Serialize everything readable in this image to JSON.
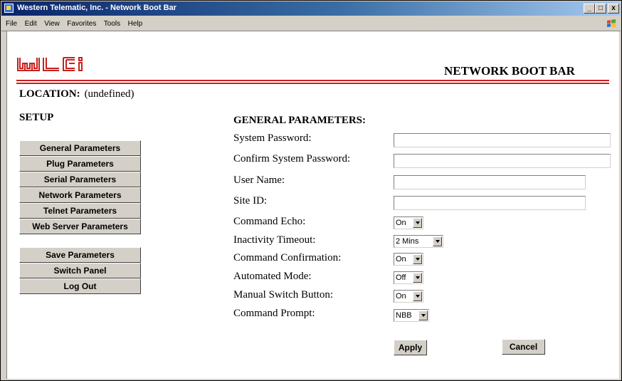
{
  "window": {
    "title": "Western Telematic, Inc. - Network Boot Bar",
    "controls": [
      "_",
      "□",
      "x"
    ]
  },
  "menubar": {
    "items": [
      "File",
      "Edit",
      "View",
      "Favorites",
      "Tools",
      "Help"
    ]
  },
  "header": {
    "logo_text": "wti",
    "product_title": "NETWORK BOOT BAR",
    "brand_color": "#c8201e"
  },
  "location": {
    "label": "LOCATION:",
    "value": "(undefined)"
  },
  "sidebar": {
    "title": "SETUP",
    "setup_items": [
      {
        "label": "General Parameters"
      },
      {
        "label": "Plug Parameters"
      },
      {
        "label": "Serial Parameters"
      },
      {
        "label": "Network Parameters"
      },
      {
        "label": "Telnet Parameters"
      },
      {
        "label": "Web Server Parameters"
      }
    ],
    "action_items": [
      {
        "label": "Save Parameters"
      },
      {
        "label": "Switch Panel"
      },
      {
        "label": "Log Out"
      }
    ]
  },
  "form": {
    "title": "GENERAL PARAMETERS:",
    "fields": {
      "system_password": {
        "label": "System Password:",
        "value": ""
      },
      "confirm_password": {
        "label": "Confirm System Password:",
        "value": ""
      },
      "user_name": {
        "label": "User Name:",
        "value": ""
      },
      "site_id": {
        "label": "Site ID:",
        "value": ""
      },
      "command_echo": {
        "label": "Command Echo:",
        "value": "On"
      },
      "inactivity_timeout": {
        "label": "Inactivity Timeout:",
        "value": "2 Mins"
      },
      "command_confirmation": {
        "label": "Command Confirmation:",
        "value": "On"
      },
      "automated_mode": {
        "label": "Automated Mode:",
        "value": "Off"
      },
      "manual_switch_button": {
        "label": "Manual Switch Button:",
        "value": "On"
      },
      "command_prompt": {
        "label": "Command Prompt:",
        "value": "NBB"
      }
    },
    "apply_label": "Apply",
    "cancel_label": "Cancel"
  }
}
